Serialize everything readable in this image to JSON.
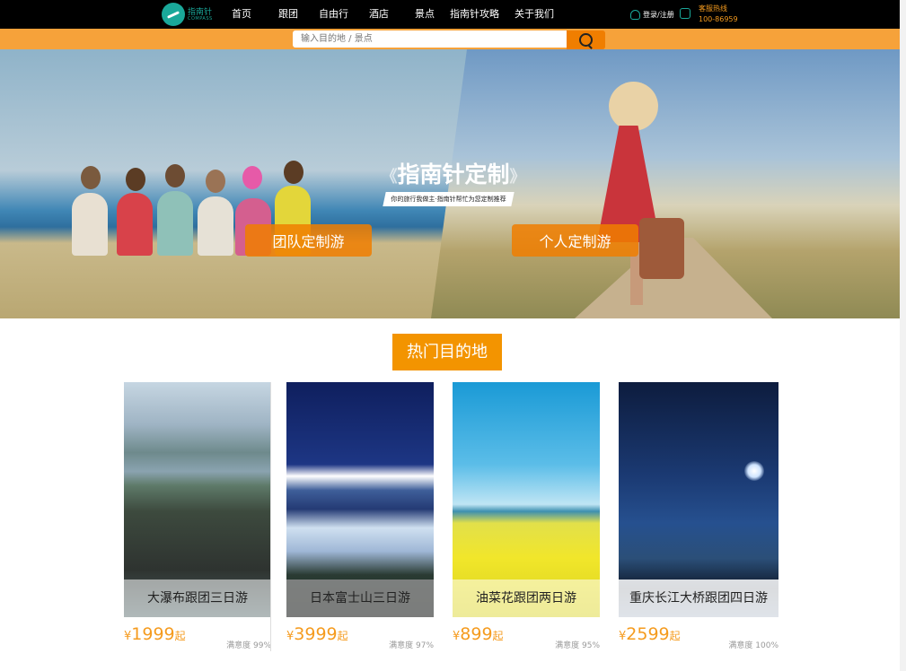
{
  "header": {
    "logo_text": "指南针",
    "logo_sub": "COMPASS",
    "nav": [
      "首页",
      "跟团",
      "自由行",
      "酒店",
      "景点",
      "指南针攻略",
      "关于我们"
    ],
    "login_label": "登录/注册",
    "hotline_label": "客服热线",
    "hotline_number": "100-86959"
  },
  "search": {
    "placeholder": "输入目的地 / 景点"
  },
  "hero": {
    "title": "指南针定制",
    "subtitle": "你的旅行我做主·指南针帮忙为您定制推荐",
    "team_button": "团队定制游",
    "personal_button": "个人定制游"
  },
  "section": {
    "title": "热门目的地"
  },
  "cards": [
    {
      "name": "大瀑布跟团三日游",
      "currency": "¥",
      "price": "1999",
      "suffix": "起",
      "satisfaction": "满意度 99%"
    },
    {
      "name": "日本富士山三日游",
      "currency": "¥",
      "price": "3999",
      "suffix": "起",
      "satisfaction": "满意度 97%"
    },
    {
      "name": "油菜花跟团两日游",
      "currency": "¥",
      "price": "899",
      "suffix": "起",
      "satisfaction": "满意度 95%"
    },
    {
      "name": "重庆长江大桥跟团四日游",
      "currency": "¥",
      "price": "2599",
      "suffix": "起",
      "satisfaction": "满意度 100%"
    }
  ],
  "colors": {
    "accent": "#f39400",
    "search_bar": "#f6a23a",
    "teal": "#1aa89a",
    "topbar": "#000000"
  }
}
